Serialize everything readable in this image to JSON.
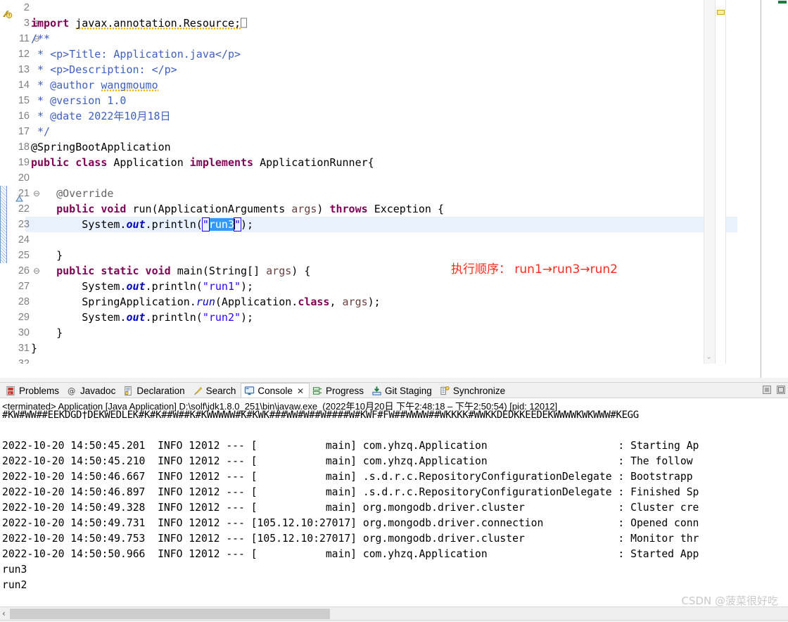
{
  "editor": {
    "name": "java-editor",
    "lines": [
      {
        "num": "2",
        "fold": "",
        "segments": []
      },
      {
        "num": "3",
        "fold": "⊕",
        "segments": [
          {
            "t": "import ",
            "c": "kw"
          },
          {
            "t": "javax.annotation.Resource;",
            "c": "plain warnsquig"
          },
          {
            "t": "⎕",
            "c": "anno"
          }
        ]
      },
      {
        "num": "11",
        "fold": "⊖",
        "segments": [
          {
            "t": "/**",
            "c": "cmt"
          }
        ]
      },
      {
        "num": "12",
        "fold": "",
        "segments": [
          {
            "t": " * <p>Title: Application.java</p>",
            "c": "cmt"
          }
        ]
      },
      {
        "num": "13",
        "fold": "",
        "segments": [
          {
            "t": " * <p>Description: </p>",
            "c": "cmt"
          }
        ]
      },
      {
        "num": "14",
        "fold": "",
        "segments": [
          {
            "t": " * @author ",
            "c": "cmt"
          },
          {
            "t": "wangmoumo",
            "c": "cmt warnsquig"
          }
        ]
      },
      {
        "num": "15",
        "fold": "",
        "segments": [
          {
            "t": " * @version 1.0",
            "c": "cmt"
          }
        ]
      },
      {
        "num": "16",
        "fold": "",
        "segments": [
          {
            "t": " * @date 2022年10月18日",
            "c": "cmt"
          }
        ]
      },
      {
        "num": "17",
        "fold": "",
        "segments": [
          {
            "t": " */",
            "c": "cmt"
          }
        ]
      },
      {
        "num": "18",
        "fold": "",
        "segments": [
          {
            "t": "@SpringBootApplication",
            "c": "plain"
          }
        ]
      },
      {
        "num": "19",
        "fold": "",
        "segments": [
          {
            "t": "public class ",
            "c": "kw"
          },
          {
            "t": "Application ",
            "c": "plain"
          },
          {
            "t": "implements ",
            "c": "kw"
          },
          {
            "t": "ApplicationRunner{",
            "c": "plain"
          }
        ]
      },
      {
        "num": "20",
        "fold": "",
        "segments": []
      },
      {
        "num": "21",
        "fold": "⊖",
        "segments": [
          {
            "t": "    @Override",
            "c": "anno"
          }
        ]
      },
      {
        "num": "22",
        "fold": "",
        "segments": [
          {
            "t": "    ",
            "c": "plain"
          },
          {
            "t": "public void ",
            "c": "kw"
          },
          {
            "t": "run(ApplicationArguments ",
            "c": "plain"
          },
          {
            "t": "args",
            "c": "localvar"
          },
          {
            "t": ") ",
            "c": "plain"
          },
          {
            "t": "throws ",
            "c": "kw"
          },
          {
            "t": "Exception {",
            "c": "plain"
          }
        ]
      },
      {
        "num": "23",
        "fold": "",
        "segments": []
      },
      {
        "num": "24",
        "fold": "",
        "segments": []
      },
      {
        "num": "25",
        "fold": "",
        "segments": [
          {
            "t": "    }",
            "c": "plain"
          }
        ]
      },
      {
        "num": "26",
        "fold": "⊖",
        "segments": [
          {
            "t": "    ",
            "c": "plain"
          },
          {
            "t": "public static void ",
            "c": "kw"
          },
          {
            "t": "main(String[] ",
            "c": "plain"
          },
          {
            "t": "args",
            "c": "localvar"
          },
          {
            "t": ") {",
            "c": "plain"
          }
        ]
      },
      {
        "num": "27",
        "fold": "",
        "segments": [
          {
            "t": "        System.",
            "c": "plain"
          },
          {
            "t": "out",
            "c": "fld"
          },
          {
            "t": ".println(",
            "c": "plain"
          },
          {
            "t": "\"run1\"",
            "c": "str"
          },
          {
            "t": ");",
            "c": "plain"
          }
        ]
      },
      {
        "num": "28",
        "fold": "",
        "segments": [
          {
            "t": "        SpringApplication.",
            "c": "plain"
          },
          {
            "t": "run",
            "c": "sm"
          },
          {
            "t": "(Application.",
            "c": "plain"
          },
          {
            "t": "class",
            "c": "kw"
          },
          {
            "t": ", ",
            "c": "plain"
          },
          {
            "t": "args",
            "c": "localvar"
          },
          {
            "t": ");",
            "c": "plain"
          }
        ]
      },
      {
        "num": "29",
        "fold": "",
        "segments": [
          {
            "t": "        System.",
            "c": "plain"
          },
          {
            "t": "out",
            "c": "fld"
          },
          {
            "t": ".println(",
            "c": "plain"
          },
          {
            "t": "\"run2\"",
            "c": "str"
          },
          {
            "t": ");",
            "c": "plain"
          }
        ]
      },
      {
        "num": "30",
        "fold": "",
        "segments": [
          {
            "t": "    }",
            "c": "plain"
          }
        ]
      },
      {
        "num": "31",
        "fold": "",
        "segments": [
          {
            "t": "}",
            "c": "plain"
          }
        ]
      },
      {
        "num": "32",
        "fold": "",
        "segments": []
      }
    ],
    "selected_line": {
      "num": "23",
      "prefix": "        System.",
      "field": "out",
      "mid": ".println(",
      "quote_open": "\"",
      "selection": "run3",
      "quote_close": "\"",
      "suffix": ");"
    },
    "annotation": "执行顺序： run1→run3→run2",
    "annotation_color": "#ff2b1a",
    "scroll_left_arrow": "‹",
    "scroll_right_arrow": "›",
    "scroll_down_arrow": "⌄",
    "warn_icon": "warning-icon",
    "selection_color": "#3399ff",
    "highlight_color": "#e8f1fc"
  },
  "tabbar": {
    "tabs": [
      {
        "label": "Problems",
        "icon": "problems-icon",
        "active": false,
        "closable": false
      },
      {
        "label": "Javadoc",
        "icon": "javadoc-icon",
        "active": false,
        "closable": false
      },
      {
        "label": "Declaration",
        "icon": "declaration-icon",
        "active": false,
        "closable": false
      },
      {
        "label": "Search",
        "icon": "search-icon",
        "active": false,
        "closable": false
      },
      {
        "label": "Console",
        "icon": "console-icon",
        "active": true,
        "closable": true
      },
      {
        "label": "Progress",
        "icon": "progress-icon",
        "active": false,
        "closable": false
      },
      {
        "label": "Git Staging",
        "icon": "git-staging-icon",
        "active": false,
        "closable": false
      },
      {
        "label": "Synchronize",
        "icon": "synchronize-icon",
        "active": false,
        "closable": false
      }
    ],
    "close_glyph": "✕",
    "right_buttons": [
      {
        "name": "minimize-view-button"
      },
      {
        "name": "maximize-view-button"
      }
    ]
  },
  "console": {
    "status_line": "<terminated> Application [Java Application] D:\\solf\\jdk1.8.0_251\\bin\\javaw.exe  (2022年10月20日 下午2:48:18 – 下午2:50:54) [pid: 12012]",
    "garbled_line": "#KW#WW##EEKDGD†DEKWEDLEK#K#K##W##K#KWWWWW#K#KWK###WW#W##W####W#KWF#FW##WWWW##WKKKK#WWKKDEDKKEEDEKWWWWKWKWWW#KEGG",
    "log_lines": [
      "2022-10-20 14:50:45.201  INFO 12012 --- [           main] com.yhzq.Application                     : Starting Ap",
      "2022-10-20 14:50:45.210  INFO 12012 --- [           main] com.yhzq.Application                     : The follow",
      "2022-10-20 14:50:46.667  INFO 12012 --- [           main] .s.d.r.c.RepositoryConfigurationDelegate : Bootstrapp",
      "2022-10-20 14:50:46.897  INFO 12012 --- [           main] .s.d.r.c.RepositoryConfigurationDelegate : Finished Sp",
      "2022-10-20 14:50:49.328  INFO 12012 --- [           main] org.mongodb.driver.cluster               : Cluster cre",
      "2022-10-20 14:50:49.731  INFO 12012 --- [105.12.10:27017] org.mongodb.driver.connection            : Opened conn",
      "2022-10-20 14:50:49.753  INFO 12012 --- [105.12.10:27017] org.mongodb.driver.cluster               : Monitor thr",
      "2022-10-20 14:50:50.966  INFO 12012 --- [           main] com.yhzq.Application                     : Started App",
      "run3",
      "run2"
    ],
    "hscroll_arrow": "‹"
  },
  "watermark": "CSDN @菠菜很好吃"
}
